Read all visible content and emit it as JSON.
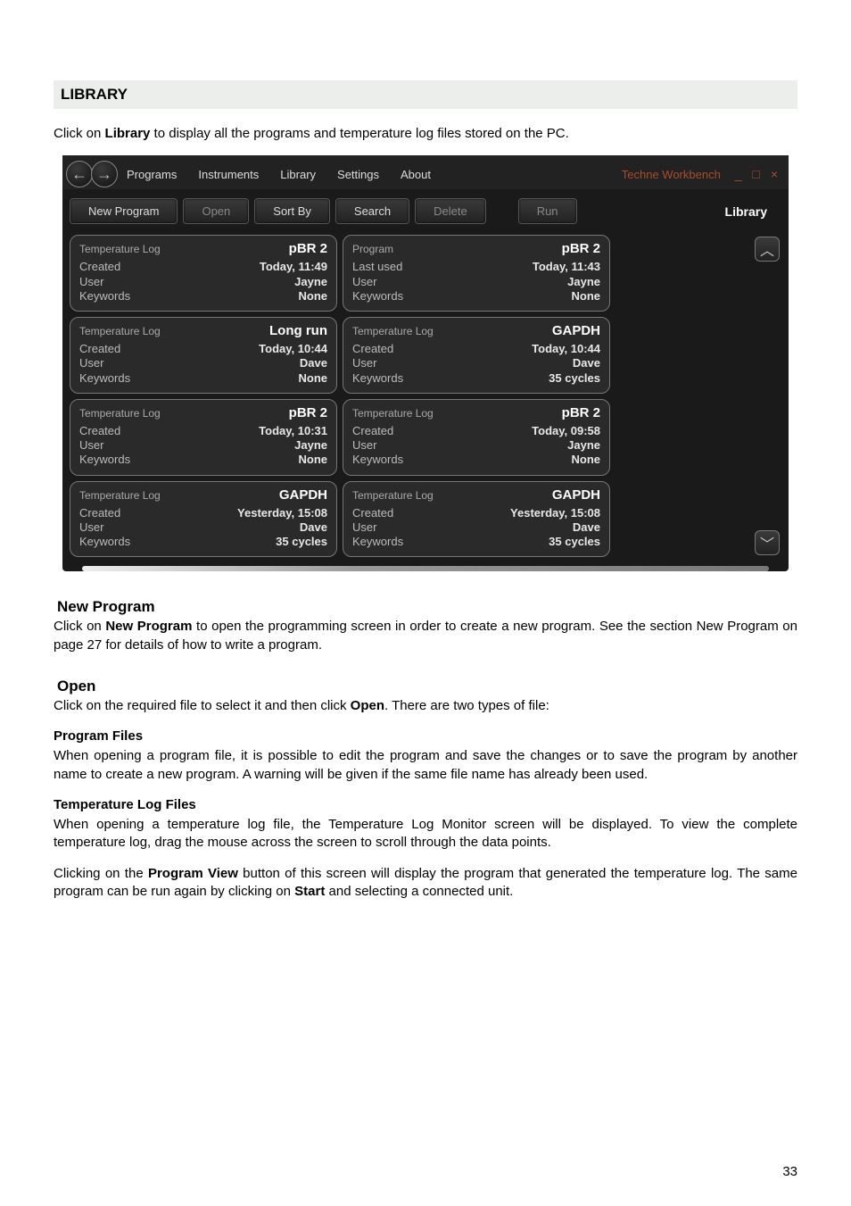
{
  "page_number": "33",
  "section_header": "LIBRARY",
  "intro_line_prefix": "Click on ",
  "intro_line_bold": "Library",
  "intro_line_suffix": " to display all the programs and temperature log files stored on the PC.",
  "window": {
    "tabs": [
      "Programs",
      "Instruments",
      "Library",
      "Settings",
      "About"
    ],
    "title": "Techne Workbench",
    "win_controls": "_ □ ×",
    "toolbar": {
      "new_program": "New Program",
      "open": "Open",
      "sort_by": "Sort By",
      "search": "Search",
      "delete": "Delete",
      "run": "Run",
      "library": "Library"
    },
    "labels": {
      "temperature_log": "Temperature Log",
      "program": "Program",
      "created": "Created",
      "last_used": "Last used",
      "user": "User",
      "keywords": "Keywords"
    },
    "left_cards": [
      {
        "type_key": "temperature_log",
        "name": "pBR 2",
        "l1_key": "created",
        "l1_val": "Today, 11:49",
        "l2_key": "user",
        "l2_val": "Jayne",
        "l3_key": "keywords",
        "l3_val": "None"
      },
      {
        "type_key": "temperature_log",
        "name": "Long run",
        "l1_key": "created",
        "l1_val": "Today, 10:44",
        "l2_key": "user",
        "l2_val": "Dave",
        "l3_key": "keywords",
        "l3_val": "None"
      },
      {
        "type_key": "temperature_log",
        "name": "pBR 2",
        "l1_key": "created",
        "l1_val": "Today, 10:31",
        "l2_key": "user",
        "l2_val": "Jayne",
        "l3_key": "keywords",
        "l3_val": "None"
      },
      {
        "type_key": "temperature_log",
        "name": "GAPDH",
        "l1_key": "created",
        "l1_val": "Yesterday, 15:08",
        "l2_key": "user",
        "l2_val": "Dave",
        "l3_key": "keywords",
        "l3_val": "35 cycles"
      }
    ],
    "right_cards": [
      {
        "type_key": "program",
        "name": "pBR 2",
        "l1_key": "last_used",
        "l1_val": "Today, 11:43",
        "l2_key": "user",
        "l2_val": "Jayne",
        "l3_key": "keywords",
        "l3_val": "None"
      },
      {
        "type_key": "temperature_log",
        "name": "GAPDH",
        "l1_key": "created",
        "l1_val": "Today, 10:44",
        "l2_key": "user",
        "l2_val": "Dave",
        "l3_key": "keywords",
        "l3_val": "35 cycles"
      },
      {
        "type_key": "temperature_log",
        "name": "pBR 2",
        "l1_key": "created",
        "l1_val": "Today, 09:58",
        "l2_key": "user",
        "l2_val": "Jayne",
        "l3_key": "keywords",
        "l3_val": "None"
      },
      {
        "type_key": "temperature_log",
        "name": "GAPDH",
        "l1_key": "created",
        "l1_val": "Yesterday, 15:08",
        "l2_key": "user",
        "l2_val": "Dave",
        "l3_key": "keywords",
        "l3_val": "35 cycles"
      }
    ]
  },
  "new_program": {
    "heading": "New Program",
    "p1_pre": "Click on ",
    "p1_bold": "New Program",
    "p1_post": " to open the programming screen in order to create a new program. See the section New Program on page 27 for details of how to write a program."
  },
  "open": {
    "heading": "Open",
    "p1_pre": "Click on the required file to select it and then click ",
    "p1_bold": "Open",
    "p1_post": ". There are two types of file:",
    "pf_heading": "Program Files",
    "pf_text": "When opening a program file, it is possible to edit the program and save the changes or to save the program by another name to create a new program. A warning will be given if the same file name has already been used.",
    "tl_heading": "Temperature Log Files",
    "tl_p1": "When opening a temperature log file, the Temperature Log Monitor screen will be displayed. To view the complete temperature log, drag the mouse across the screen to scroll through the data points.",
    "tl_p2_pre": "Clicking on the ",
    "tl_p2_b1": "Program View",
    "tl_p2_mid": " button of this screen will display the program that generated the temperature log. The same program can be run again by clicking on ",
    "tl_p2_b2": "Start",
    "tl_p2_post": " and selecting a connected unit."
  }
}
